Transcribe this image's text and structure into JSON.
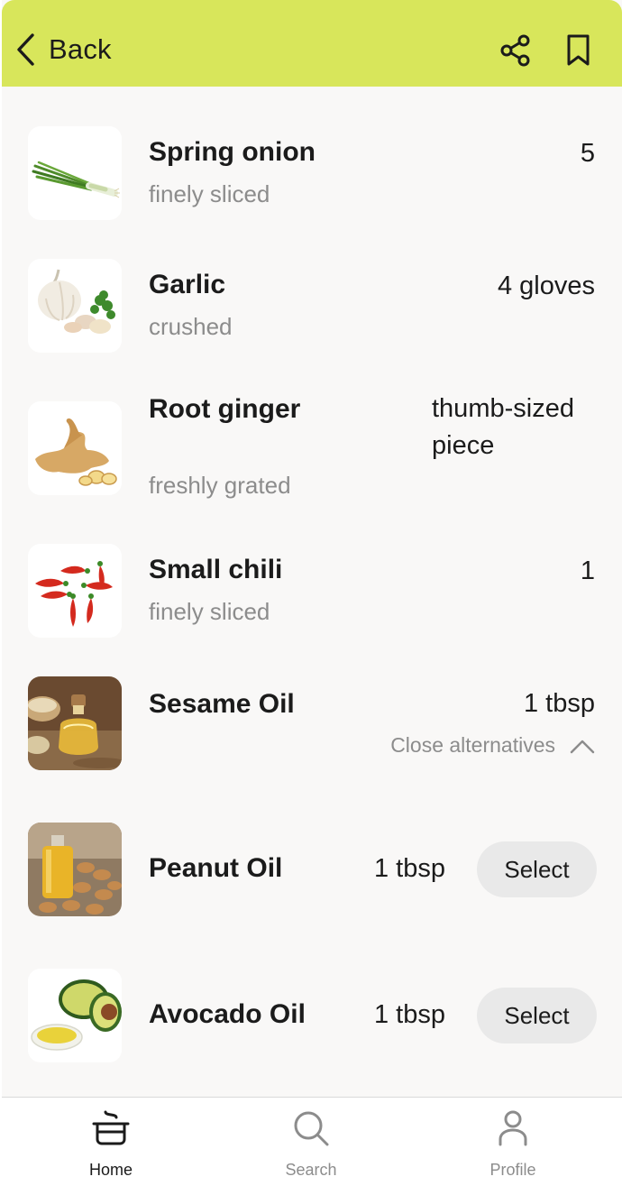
{
  "header": {
    "back_label": "Back",
    "background": "#d8e65b"
  },
  "ingredients": [
    {
      "name": "Spring onion",
      "prep": "finely sliced",
      "qty": "5",
      "image": "spring-onion-image"
    },
    {
      "name": "Garlic",
      "prep": "crushed",
      "qty": "4 gloves",
      "image": "garlic-image"
    },
    {
      "name": "Root ginger",
      "prep": "freshly grated",
      "qty": "thumb-sized piece",
      "image": "ginger-image"
    },
    {
      "name": "Small chili",
      "prep": "finely sliced",
      "qty": "1",
      "image": "chili-image"
    },
    {
      "name": "Sesame Oil",
      "qty": "1 tbsp",
      "alt_toggle": "Close alternatives",
      "image": "sesame-oil-image"
    }
  ],
  "alternatives": [
    {
      "name": "Peanut Oil",
      "qty": "1 tbsp",
      "button": "Select",
      "image": "peanut-oil-image"
    },
    {
      "name": "Avocado Oil",
      "qty": "1 tbsp",
      "button": "Select",
      "image": "avocado-oil-image"
    }
  ],
  "tabbar": {
    "tabs": [
      {
        "label": "Home",
        "icon": "pot-icon",
        "active": true
      },
      {
        "label": "Search",
        "icon": "search-icon",
        "active": false
      },
      {
        "label": "Profile",
        "icon": "person-icon",
        "active": false
      }
    ]
  },
  "colors": {
    "accent": "#d8e65b",
    "background": "#f9f8f7",
    "text_primary": "#1b1b1b",
    "text_secondary": "#8c8c8c",
    "button_bg": "#e9e9e9"
  }
}
